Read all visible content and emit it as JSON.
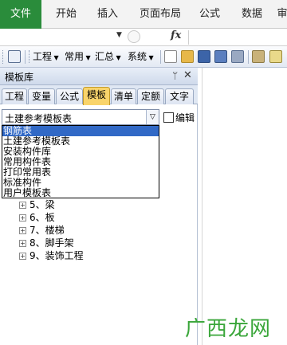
{
  "ribbon": {
    "tabs": [
      "文件",
      "开始",
      "插入",
      "页面布局",
      "公式",
      "数据",
      "审"
    ]
  },
  "formula_bar": {
    "fx": "fx"
  },
  "toolbar": {
    "menus": [
      "工程",
      "常用",
      "汇总",
      "系统"
    ]
  },
  "panel": {
    "title": "模板库",
    "pin": "ᛘ",
    "close": "✕",
    "tabs": [
      "工程",
      "变量",
      "公式",
      "模板",
      "清单",
      "定额",
      "文字"
    ],
    "active_tab": "模板",
    "combo_value": "土建参考模板表",
    "checkbox_label": "编辑",
    "dropdown_options": [
      "钢筋表",
      "土建参考模板表",
      "安装构件库",
      "常用构件表",
      "打印常用表",
      "标准构件",
      "用户模板表"
    ],
    "selected_option": "钢筋表",
    "tree_items": [
      "5、梁",
      "6、板",
      "7、楼梯",
      "8、脚手架",
      "9、装饰工程"
    ]
  },
  "watermark": "广西龙网",
  "colors": {
    "file_tab": "#2a8c3b",
    "active_tab": "#f9d46b",
    "selection": "#3169c6",
    "watermark": "#3aa63a"
  }
}
